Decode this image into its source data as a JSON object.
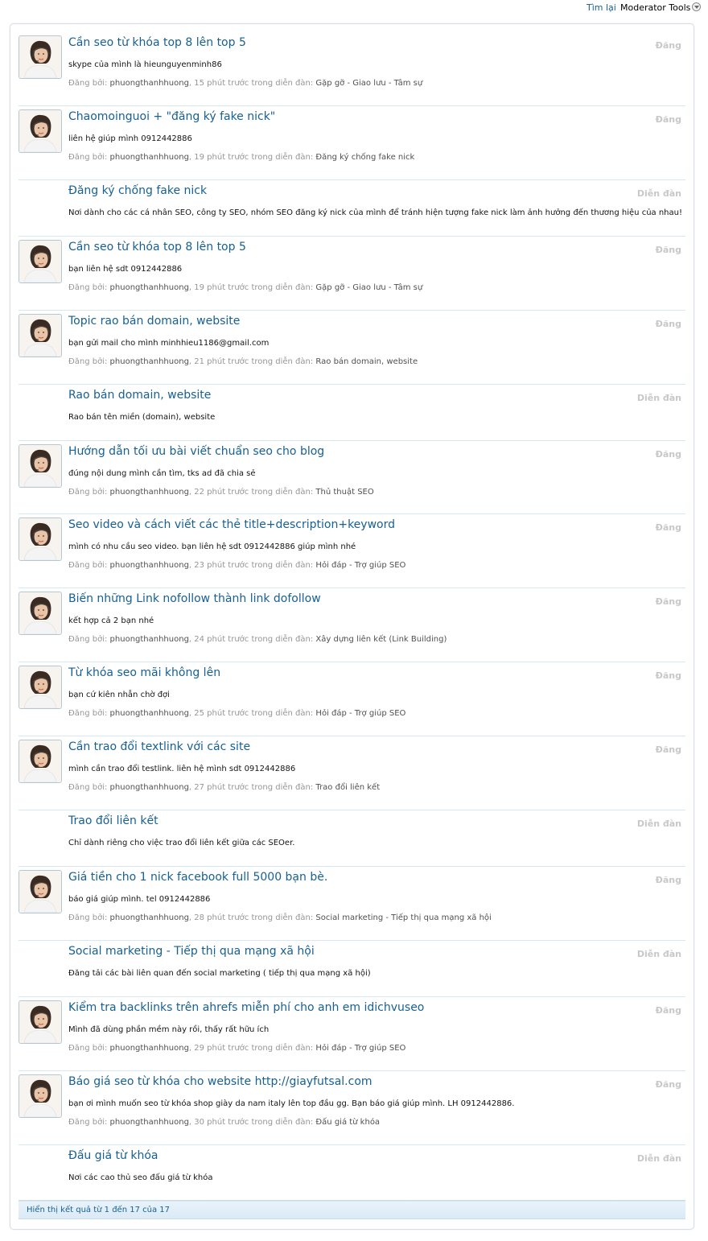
{
  "topbar": {
    "back_label": "Tìm lại",
    "mod_tools_label": "Moderator Tools"
  },
  "results": [
    {
      "title": "Cần seo từ khóa top 8 lên top 5",
      "snippet": "skype của mình là hieunguyenminh86",
      "has_avatar": true,
      "meta_prefix": "Đăng bởi: ",
      "user": "phuongthanhhuong",
      "time": ", 15 phút trước trong diễn đàn: ",
      "forum": "Gặp gỡ - Giao lưu - Tâm sự",
      "type": "Đăng"
    },
    {
      "title": "Chaomoinguoi + \"đăng ký fake nick\"",
      "snippet": "liên hệ giúp mình 0912442886",
      "has_avatar": true,
      "meta_prefix": "Đăng bởi: ",
      "user": "phuongthanhhuong",
      "time": ", 19 phút trước trong diễn đàn: ",
      "forum": "Đăng ký chống fake nick",
      "type": "Đăng"
    },
    {
      "title": "Đăng ký chống fake nick",
      "snippet": "Nơi dành cho các cá nhân SEO, công ty SEO, nhóm SEO đăng ký nick của mình để tránh hiện tượng fake nick làm ảnh hưởng đến thương hiệu của nhau!",
      "has_avatar": false,
      "type": "Diễn đàn"
    },
    {
      "title": "Cần seo từ khóa top 8 lên top 5",
      "snippet": "bạn liên hệ sdt 0912442886",
      "has_avatar": true,
      "meta_prefix": "Đăng bởi: ",
      "user": "phuongthanhhuong",
      "time": ", 19 phút trước trong diễn đàn: ",
      "forum": "Gặp gỡ - Giao lưu - Tâm sự",
      "type": "Đăng"
    },
    {
      "title": "Topic rao bán domain, website",
      "snippet": "bạn gửi mail cho mình minhhieu1186@gmail.com",
      "has_avatar": true,
      "meta_prefix": "Đăng bởi: ",
      "user": "phuongthanhhuong",
      "time": ", 21 phút trước trong diễn đàn: ",
      "forum": "Rao bán domain, website",
      "type": "Đăng"
    },
    {
      "title": "Rao bán domain, website",
      "snippet": "Rao bán tên miền (domain), website",
      "has_avatar": false,
      "type": "Diễn đàn"
    },
    {
      "title": "Hướng dẫn tối ưu bài viết chuẩn seo cho blog",
      "snippet": "đúng nội dung mình cần tìm, tks ad đã chia sẻ",
      "has_avatar": true,
      "meta_prefix": "Đăng bởi: ",
      "user": "phuongthanhhuong",
      "time": ", 22 phút trước trong diễn đàn: ",
      "forum": "Thủ thuật SEO",
      "type": "Đăng"
    },
    {
      "title": "Seo video và cách viết các thẻ title+description+keyword",
      "snippet": "mình có nhu cầu seo video. bạn liên hệ sdt 0912442886 giúp mình nhé",
      "has_avatar": true,
      "meta_prefix": "Đăng bởi: ",
      "user": "phuongthanhhuong",
      "time": ", 23 phút trước trong diễn đàn: ",
      "forum": "Hỏi đáp - Trợ giúp SEO",
      "type": "Đăng"
    },
    {
      "title": "Biến những Link nofollow thành link dofollow",
      "snippet": "kết hợp cả 2 bạn nhé",
      "has_avatar": true,
      "meta_prefix": "Đăng bởi: ",
      "user": "phuongthanhhuong",
      "time": ", 24 phút trước trong diễn đàn: ",
      "forum": "Xây dựng liên kết (Link Building)",
      "type": "Đăng"
    },
    {
      "title": "Từ khóa seo mãi không lên",
      "snippet": "bạn cứ kiên nhẫn chờ đợi",
      "has_avatar": true,
      "meta_prefix": "Đăng bởi: ",
      "user": "phuongthanhhuong",
      "time": ", 25 phút trước trong diễn đàn: ",
      "forum": "Hỏi đáp - Trợ giúp SEO",
      "type": "Đăng"
    },
    {
      "title": "Cần trao đổi textlink với các site",
      "snippet": "mình cần trao đổi testlink. liên hệ mình sdt 0912442886",
      "has_avatar": true,
      "meta_prefix": "Đăng bởi: ",
      "user": "phuongthanhhuong",
      "time": ", 27 phút trước trong diễn đàn: ",
      "forum": "Trao đổi liên kết",
      "type": "Đăng"
    },
    {
      "title": "Trao đổi liên kết",
      "snippet": "Chỉ dành riêng cho việc trao đổi liên kết giữa các SEOer.",
      "has_avatar": false,
      "type": "Diễn đàn"
    },
    {
      "title": "Giá tiền cho 1 nick facebook full 5000 bạn bè.",
      "snippet": "báo giá giúp mình. tel 0912442886",
      "has_avatar": true,
      "meta_prefix": "Đăng bởi: ",
      "user": "phuongthanhhuong",
      "time": ", 28 phút trước trong diễn đàn: ",
      "forum": "Social marketing - Tiếp thị qua mạng xã hội",
      "type": "Đăng"
    },
    {
      "title": "Social marketing - Tiếp thị qua mạng xã hội",
      "snippet": "Đăng tải các bài liên quan đến social marketing ( tiếp thị qua mạng xã hội)",
      "has_avatar": false,
      "type": "Diễn đàn"
    },
    {
      "title": "Kiểm tra backlinks trên ahrefs miễn phí cho anh em idichvuseo",
      "snippet": "Mình đã dùng phần mềm này rồi, thấy rất hữu ích",
      "has_avatar": true,
      "meta_prefix": "Đăng bởi: ",
      "user": "phuongthanhhuong",
      "time": ", 29 phút trước trong diễn đàn: ",
      "forum": "Hỏi đáp - Trợ giúp SEO",
      "type": "Đăng"
    },
    {
      "title": "Báo giá seo từ khóa cho website http://giayfutsal.com",
      "snippet": "bạn ơi mình muốn seo từ khóa shop giày da nam italy lên top đầu gg. Bạn báo giá giúp mình. LH 0912442886.",
      "has_avatar": true,
      "meta_prefix": "Đăng bởi: ",
      "user": "phuongthanhhuong",
      "time": ", 30 phút trước trong diễn đàn: ",
      "forum": "Đấu giá từ khóa",
      "type": "Đăng"
    },
    {
      "title": "Đấu giá từ khóa",
      "snippet": "Nơi các cao thủ seo đấu giá từ khóa",
      "has_avatar": false,
      "type": "Diễn đàn"
    }
  ],
  "footer": {
    "results_text": "Hiển thị kết quả từ 1 đến 17 của 17"
  },
  "colors": {
    "link": "#176093",
    "muted": "#969696",
    "border": "#d8e6ef"
  }
}
